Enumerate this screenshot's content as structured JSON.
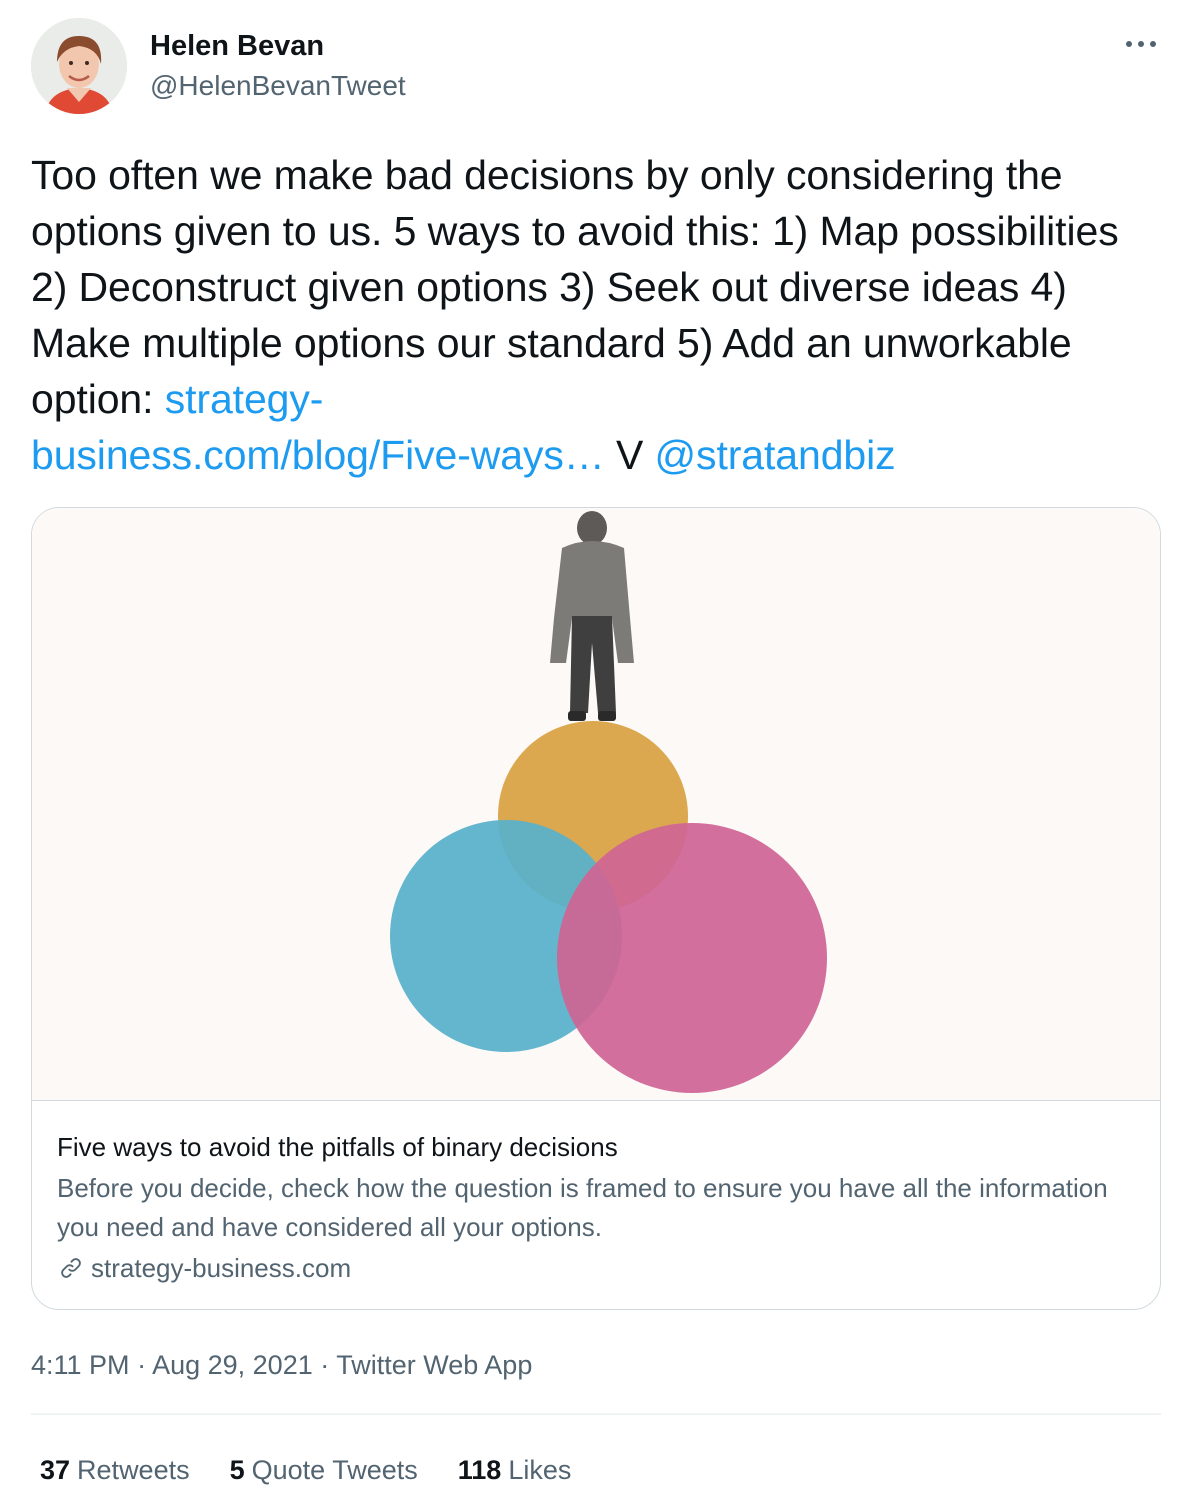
{
  "author": {
    "name": "Helen Bevan",
    "handle": "@HelenBevanTweet"
  },
  "more_label": "···",
  "tweet": {
    "text_part1": "Too often we make bad decisions by only considering the options given to us. 5 ways to avoid this: 1) Map possibilities 2) Deconstruct given options 3) Seek out diverse ideas 4) Make multiple options our standard 5) Add an unworkable option: ",
    "link_text_line1": "strategy-",
    "link_text_line2": "business.com/blog/Five-ways…",
    "text_part2": " V ",
    "mention": "@stratandbiz"
  },
  "card": {
    "title": "Five ways to avoid the pitfalls of binary decisions",
    "description": "Before you decide, check how the question is framed to ensure you have all the information you need and have considered all your options.",
    "domain": "strategy-business.com",
    "icon": "link-icon"
  },
  "meta": {
    "time": "4:11 PM",
    "separator": " · ",
    "date": "Aug 29, 2021",
    "source": "Twitter Web App"
  },
  "stats": {
    "retweets_count": "37",
    "retweets_label": "Retweets",
    "quotes_count": "5",
    "quotes_label": "Quote Tweets",
    "likes_count": "118",
    "likes_label": "Likes"
  },
  "colors": {
    "link": "#1d9bf0",
    "secondary_text": "#536471",
    "primary_text": "#0f1419",
    "card_border": "#cfd9de",
    "circle_yellow": "#dca84a",
    "circle_blue": "#58b5d4",
    "circle_pink": "#d2669a"
  }
}
